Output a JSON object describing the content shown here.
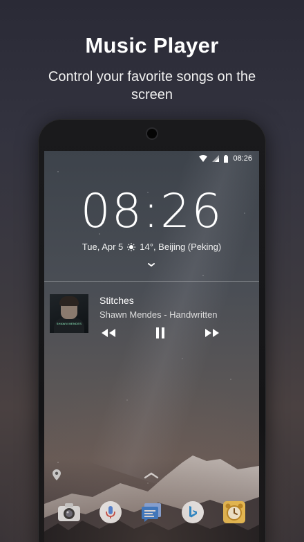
{
  "promo": {
    "title": "Music Player",
    "subtitle": "Control your favorite songs on the screen"
  },
  "status_bar": {
    "time": "08:26",
    "icons": [
      "wifi-icon",
      "signal-icon",
      "battery-icon"
    ]
  },
  "lockscreen": {
    "clock": "08:26",
    "date": "Tue, Apr 5",
    "weather_icon": "sun-icon",
    "weather": "14°, Beijing (Peking)"
  },
  "music": {
    "title": "Stitches",
    "artist_album": "Shawn Mendes - Handwritten",
    "album_art_text": "SHAWN MENDES",
    "controls": [
      "rewind-icon",
      "pause-icon",
      "fast-forward-icon"
    ]
  },
  "dock": {
    "apps": [
      "camera-app-icon",
      "voice-search-app-icon",
      "messages-app-icon",
      "bing-app-icon",
      "alarm-clock-app-icon"
    ]
  },
  "colors": {
    "accent_blue": "#1a8fe0",
    "alarm_yellow": "#f2c14e",
    "messages_blue": "#2a7de1"
  }
}
